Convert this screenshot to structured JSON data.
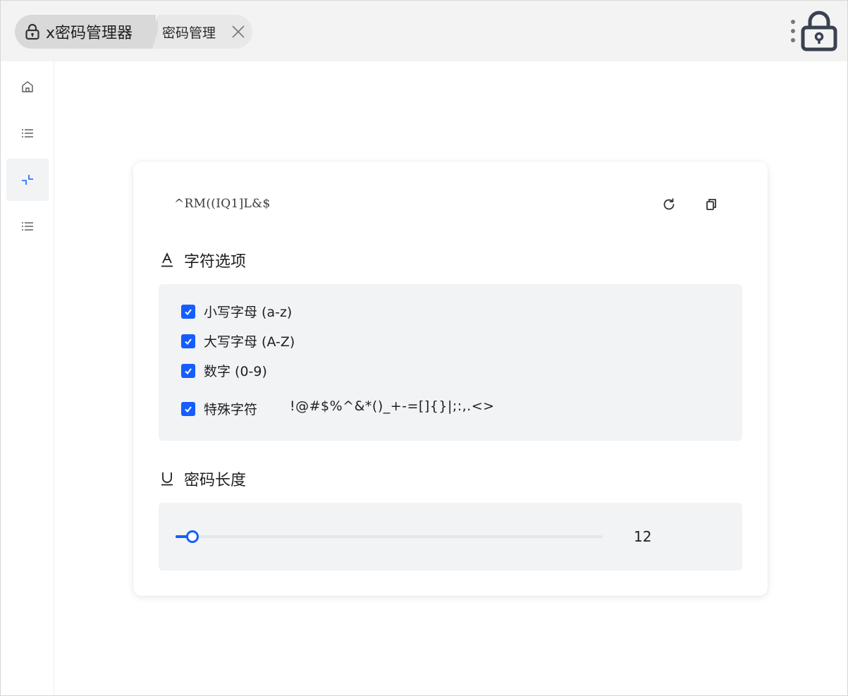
{
  "header": {
    "app_title": "x密码管理器",
    "tab_title": "密码管理",
    "icons": [
      "lock-icon",
      "close-icon",
      "more-vertical-icon",
      "lock-icon"
    ]
  },
  "sidebar": {
    "items": [
      {
        "name": "home",
        "icon": "home-icon",
        "active": false
      },
      {
        "name": "list",
        "icon": "list-icon",
        "active": false
      },
      {
        "name": "generator",
        "icon": "shrink-icon",
        "active": true
      },
      {
        "name": "list-2",
        "icon": "list-icon",
        "active": false
      }
    ]
  },
  "generator": {
    "password": "^RM((IQ1]L&$",
    "refresh_icon": "refresh-icon",
    "copy_icon": "copy-icon",
    "char_options": {
      "title": "字符选项",
      "icon": "font-icon",
      "options": [
        {
          "label": "小写字母 (a-z)",
          "checked": true
        },
        {
          "label": "大写字母 (A-Z)",
          "checked": true
        },
        {
          "label": "数字 (0-9)",
          "checked": true
        },
        {
          "label": "特殊字符",
          "checked": true
        }
      ],
      "special_chars": "!@#$%^&*()_+-=[]{}|;:,.<>"
    },
    "length": {
      "title": "密码长度",
      "icon": "underline-icon",
      "value": "12",
      "slider_fraction": 0.04
    }
  },
  "colors": {
    "accent": "#165dff",
    "panel_bg": "#f2f3f5",
    "topbar_bg": "#f3f3f3"
  }
}
